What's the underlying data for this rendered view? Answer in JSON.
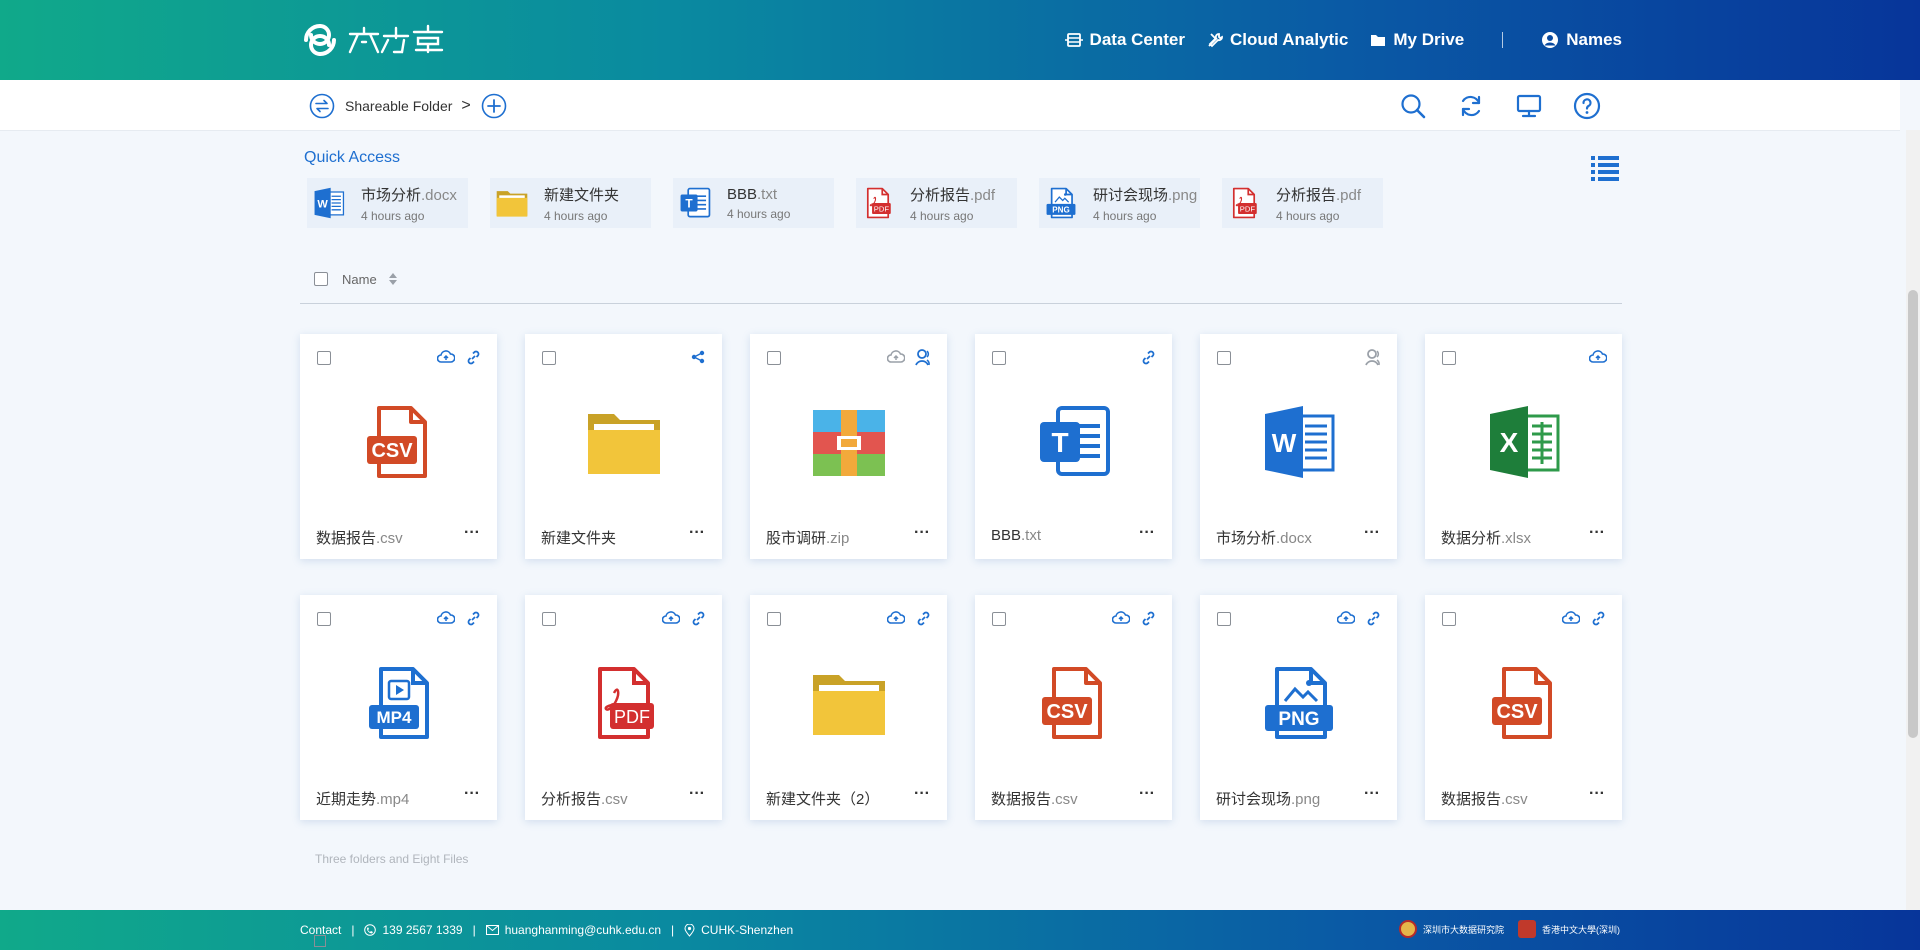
{
  "header": {
    "brand_icon": "spiral-logo-icon",
    "nav": [
      {
        "label": "Data Center",
        "icon": "database-icon"
      },
      {
        "label": "Cloud Analytic",
        "icon": "tools-icon"
      },
      {
        "label": "My Drive",
        "icon": "folder-icon"
      }
    ],
    "user": {
      "label": "Names",
      "icon": "user-circle-icon"
    }
  },
  "toolbar": {
    "breadcrumb_label": "Shareable Folder",
    "breadcrumb_separator": ">",
    "tools": [
      "search-icon",
      "refresh-icon",
      "monitor-icon",
      "help-icon"
    ]
  },
  "quick_access": {
    "title": "Quick Access",
    "items": [
      {
        "name": "市场分析",
        "ext": ".docx",
        "time": "4 hours ago",
        "type": "word"
      },
      {
        "name": "新建文件夹",
        "ext": "",
        "time": "4 hours ago",
        "type": "folder"
      },
      {
        "name": "BBB",
        "ext": ".txt",
        "time": "4 hours ago",
        "type": "txt"
      },
      {
        "name": "分析报告",
        "ext": ".pdf",
        "time": "4 hours ago",
        "type": "pdf"
      },
      {
        "name": "研讨会现场",
        "ext": ".png",
        "time": "4 hours ago",
        "type": "png"
      },
      {
        "name": "分析报告",
        "ext": ".pdf",
        "time": "4 hours ago",
        "type": "pdf"
      }
    ]
  },
  "list_header": {
    "name_label": "Name"
  },
  "files": [
    {
      "name": "数据报告",
      "ext": ".csv",
      "type": "csv",
      "badges": [
        "cloud",
        "link"
      ]
    },
    {
      "name": "新建文件夹",
      "ext": "",
      "type": "folder",
      "badges": [
        "share"
      ]
    },
    {
      "name": "股市调研",
      "ext": ".zip",
      "type": "zip",
      "badges": [
        "cloud-grey",
        "user"
      ]
    },
    {
      "name": "BBB",
      "ext": ".txt",
      "type": "txt",
      "badges": [
        "link"
      ]
    },
    {
      "name": "市场分析",
      "ext": ".docx",
      "type": "word",
      "badges": [
        "user-grey"
      ]
    },
    {
      "name": "数据分析",
      "ext": ".xlsx",
      "type": "excel",
      "badges": [
        "cloud"
      ]
    },
    {
      "name": "近期走势",
      "ext": ".mp4",
      "type": "mp4",
      "badges": [
        "cloud",
        "link"
      ]
    },
    {
      "name": "分析报告",
      "ext": ".csv",
      "type": "pdf",
      "badges": [
        "cloud",
        "link"
      ]
    },
    {
      "name": "新建文件夹（2）",
      "ext": "",
      "type": "folder",
      "badges": [
        "cloud",
        "link"
      ]
    },
    {
      "name": "数据报告",
      "ext": ".csv",
      "type": "csv",
      "badges": [
        "cloud",
        "link"
      ]
    },
    {
      "name": "研讨会现场",
      "ext": ".png",
      "type": "png",
      "badges": [
        "cloud",
        "link"
      ]
    },
    {
      "name": "数据报告",
      "ext": ".csv",
      "type": "csv",
      "badges": [
        "cloud",
        "link"
      ]
    }
  ],
  "more_label": "···",
  "summary": "Three folders and Eight Files",
  "footer": {
    "contact_label": "Contact",
    "phone": "139 2567 1339",
    "email": "huanghanming@cuhk.edu.cn",
    "location": "CUHK-Shenzhen",
    "partners": [
      "深圳市大数据研究院",
      "香港中文大學(深圳)"
    ]
  },
  "colors": {
    "accent": "#1e6fd0",
    "header_start": "#10a98a",
    "header_end": "#07359a",
    "csv": "#d24a26",
    "pdf": "#d32f2f",
    "word": "#1e6fd0",
    "excel": "#1e7e3a",
    "folder": "#f2c53a"
  }
}
